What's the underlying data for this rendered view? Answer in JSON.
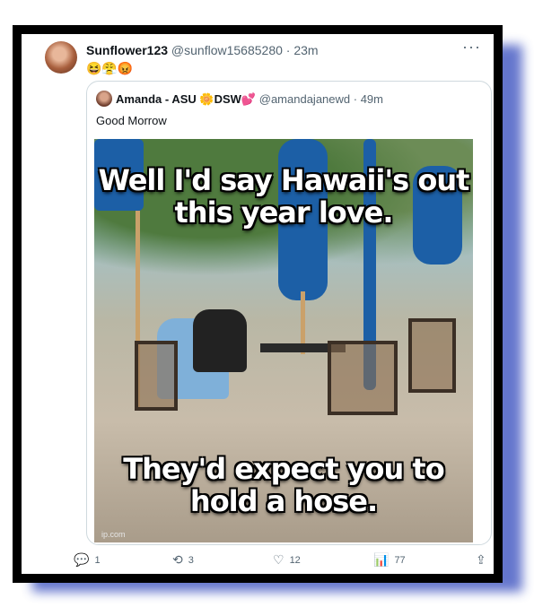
{
  "post": {
    "display_name": "Sunflower123",
    "handle": "@sunflow15685280",
    "time": "· 23m",
    "emojis": "😆😤😡",
    "more": "···"
  },
  "quoted": {
    "display_name": "Amanda - ASU 🌼DSW💕",
    "handle": "@amandajanewd",
    "time": "· 49m",
    "text": "Good Morrow",
    "meme_top": "Well I'd say Hawaii's out this year love.",
    "meme_bottom": "They'd expect you to hold a hose.",
    "watermark": "ip.com"
  },
  "actions": {
    "reply_count": "1",
    "retweet_count": "3",
    "like_count": "12",
    "views_count": "77"
  },
  "icons": {
    "reply": "reply-icon",
    "retweet": "retweet-icon",
    "like": "heart-icon",
    "views": "views-icon",
    "share": "share-icon"
  }
}
